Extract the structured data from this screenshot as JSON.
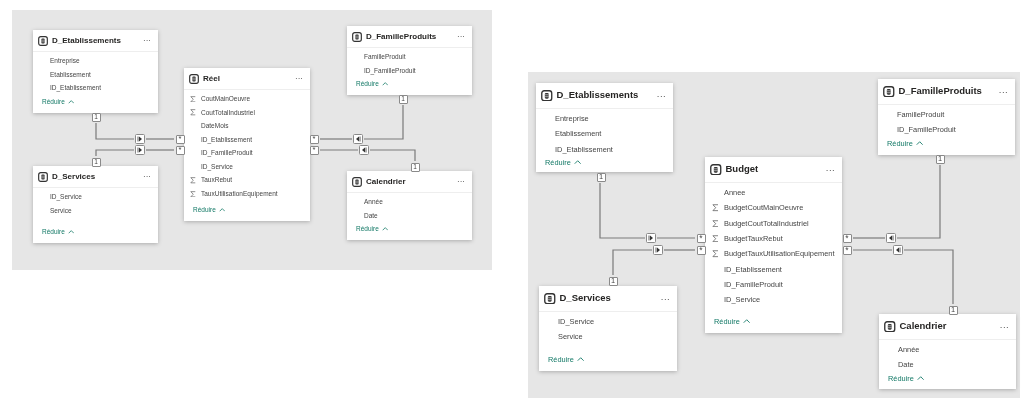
{
  "diagrams": [
    {
      "tables": [
        {
          "name": "D_Etablissements",
          "more": "···",
          "fields": [
            {
              "name": "Entreprise",
              "kind": "column"
            },
            {
              "name": "Etablissement",
              "kind": "column"
            },
            {
              "name": "ID_Etablissement",
              "kind": "column"
            }
          ],
          "collapse": "Réduire"
        },
        {
          "name": "D_Services",
          "more": "···",
          "fields": [
            {
              "name": "ID_Service",
              "kind": "column"
            },
            {
              "name": "Service",
              "kind": "column"
            }
          ],
          "collapse": "Réduire"
        },
        {
          "name": "Réel",
          "more": "···",
          "fields": [
            {
              "name": "CoutMainOeuvre",
              "kind": "measure"
            },
            {
              "name": "CoutTotalIndustriel",
              "kind": "measure"
            },
            {
              "name": "DateMois",
              "kind": "column"
            },
            {
              "name": "ID_Etablissement",
              "kind": "column"
            },
            {
              "name": "ID_FamilleProduit",
              "kind": "column"
            },
            {
              "name": "ID_Service",
              "kind": "column"
            },
            {
              "name": "TauxRebut",
              "kind": "measure"
            },
            {
              "name": "TauxUtilisationEquipement",
              "kind": "measure"
            }
          ],
          "collapse": "Réduire"
        },
        {
          "name": "D_FamilleProduits",
          "more": "···",
          "fields": [
            {
              "name": "FamilleProduit",
              "kind": "column"
            },
            {
              "name": "ID_FamilleProduit",
              "kind": "column"
            }
          ],
          "collapse": "Réduire"
        },
        {
          "name": "Calendrier",
          "more": "···",
          "fields": [
            {
              "name": "Année",
              "kind": "column"
            },
            {
              "name": "Date",
              "kind": "column"
            }
          ],
          "collapse": "Réduire"
        }
      ],
      "relationships": [
        {
          "one": "1",
          "many": "*"
        },
        {
          "one": "1",
          "many": "*"
        },
        {
          "one": "1",
          "many": "*"
        },
        {
          "one": "1",
          "many": "*"
        }
      ]
    },
    {
      "tables": [
        {
          "name": "D_Etablissements",
          "more": "···",
          "fields": [
            {
              "name": "Entreprise",
              "kind": "column"
            },
            {
              "name": "Etablissement",
              "kind": "column"
            },
            {
              "name": "ID_Etablissement",
              "kind": "column"
            }
          ],
          "collapse": "Réduire"
        },
        {
          "name": "D_Services",
          "more": "···",
          "fields": [
            {
              "name": "ID_Service",
              "kind": "column"
            },
            {
              "name": "Service",
              "kind": "column"
            }
          ],
          "collapse": "Réduire"
        },
        {
          "name": "Budget",
          "more": "···",
          "fields": [
            {
              "name": "Annee",
              "kind": "column"
            },
            {
              "name": "BudgetCoutMainOeuvre",
              "kind": "measure"
            },
            {
              "name": "BudgetCoutTotalIndustriel",
              "kind": "measure"
            },
            {
              "name": "BudgetTauxRebut",
              "kind": "measure"
            },
            {
              "name": "BudgetTauxUtilisationEquipement",
              "kind": "measure"
            },
            {
              "name": "ID_Etablissement",
              "kind": "column"
            },
            {
              "name": "ID_FamilleProduit",
              "kind": "column"
            },
            {
              "name": "ID_Service",
              "kind": "column"
            }
          ],
          "collapse": "Réduire"
        },
        {
          "name": "D_FamilleProduits",
          "more": "···",
          "fields": [
            {
              "name": "FamilleProduit",
              "kind": "column"
            },
            {
              "name": "ID_FamilleProduit",
              "kind": "column"
            }
          ],
          "collapse": "Réduire"
        },
        {
          "name": "Calendrier",
          "more": "···",
          "fields": [
            {
              "name": "Année",
              "kind": "column"
            },
            {
              "name": "Date",
              "kind": "column"
            }
          ],
          "collapse": "Réduire"
        }
      ],
      "relationships": [
        {
          "one": "1",
          "many": "*"
        },
        {
          "one": "1",
          "many": "*"
        },
        {
          "one": "1",
          "many": "*"
        },
        {
          "one": "1",
          "many": "*"
        }
      ]
    }
  ]
}
